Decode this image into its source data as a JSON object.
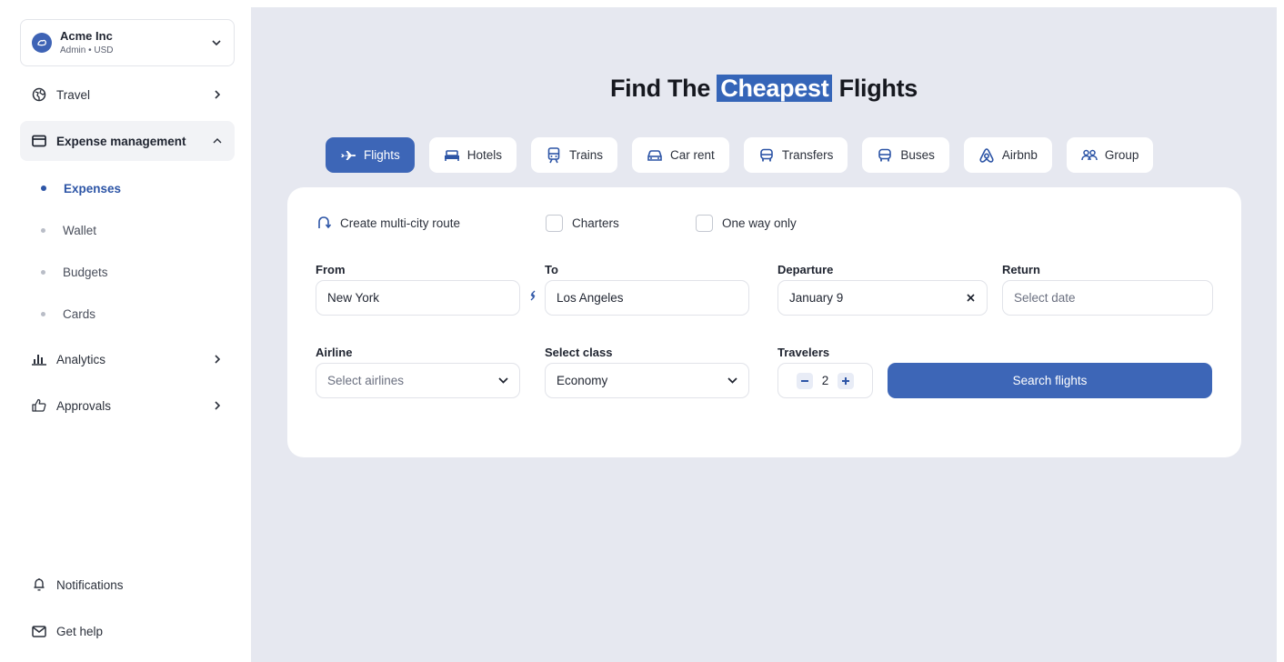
{
  "workspace": {
    "name": "Acme Inc",
    "sub": "Admin • USD"
  },
  "nav": {
    "travel": "Travel",
    "expense": "Expense management",
    "expenses": "Expenses",
    "wallet": "Wallet",
    "budgets": "Budgets",
    "cards": "Cards",
    "analytics": "Analytics",
    "approvals": "Approvals",
    "notifications": "Notifications",
    "help": "Get help"
  },
  "headline": {
    "before": "Find The ",
    "highlight": "Cheapest",
    "after": " Flights"
  },
  "tabs": {
    "flights": "Flights",
    "hotels": "Hotels",
    "trains": "Trains",
    "car_rent": "Car rent",
    "transfers": "Transfers",
    "buses": "Buses",
    "airbnb": "Airbnb",
    "group": "Group"
  },
  "options": {
    "multi_city": "Create multi-city route",
    "charters": "Charters",
    "one_way": "One way only"
  },
  "form": {
    "from_label": "From",
    "from_value": "New York",
    "to_label": "To",
    "to_value": "Los Angeles",
    "departure_label": "Departure",
    "departure_value": "January 9",
    "return_label": "Return",
    "return_placeholder": "Select date",
    "airline_label": "Airline",
    "airline_placeholder": "Select airlines",
    "class_label": "Select class",
    "class_value": "Economy",
    "travelers_label": "Travelers",
    "travelers_value": "2",
    "search_label": "Search flights"
  },
  "colors": {
    "accent": "#3d66b7",
    "background": "#e6e8f0"
  }
}
